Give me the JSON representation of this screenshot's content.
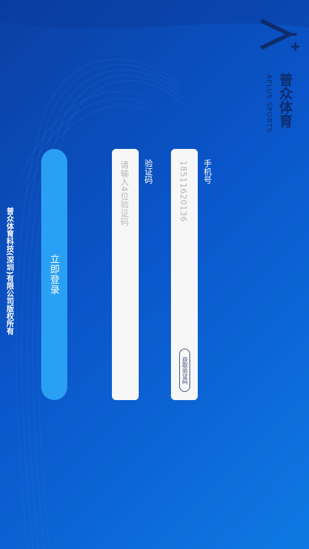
{
  "brand": {
    "name_cn": "普众体育",
    "name_en": "APLUS SPORTS"
  },
  "form": {
    "phone_label": "手机号",
    "phone_value": "18511620136",
    "code_label": "验证码",
    "code_placeholder": "请输入4位验证码",
    "send_code_label": "获取验证码",
    "login_label": "立即登录"
  },
  "footer": {
    "copyright": "普众体育科技(深圳)有限公司版权所有"
  },
  "colors": {
    "background_start": "#0b3fa3",
    "background_end": "#0e79e2",
    "button": "#2aa0f5",
    "field_bg": "#f7f7f7",
    "logo": "#0e2c6d"
  }
}
